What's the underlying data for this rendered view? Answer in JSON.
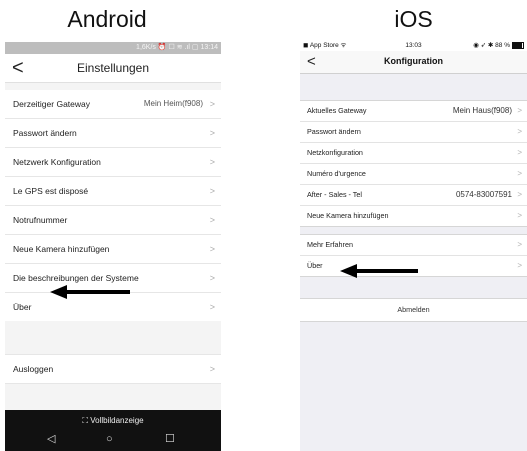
{
  "captions": {
    "android": "Android",
    "ios": "iOS"
  },
  "android": {
    "status_text": "1,6K/s ⏰ ☐ ≋ .ıl ▢ 13:14",
    "title": "Einstellungen",
    "back_glyph": "<",
    "items": [
      {
        "label": "Derzeitiger Gateway",
        "value": "Mein Heim(f908)"
      },
      {
        "label": "Passwort ändern",
        "value": ""
      },
      {
        "label": "Netzwerk Konfiguration",
        "value": ""
      },
      {
        "label": "Le GPS est disposé",
        "value": ""
      },
      {
        "label": "Notrufnummer",
        "value": ""
      },
      {
        "label": "Neue Kamera hinzufügen",
        "value": ""
      },
      {
        "label": "Die beschreibungen der Systeme",
        "value": ""
      },
      {
        "label": "Über",
        "value": ""
      }
    ],
    "logout": "Ausloggen",
    "fullscreen": "⛶ Vollbildanzeige",
    "nav": {
      "back": "◁",
      "home": "○",
      "recent": "☐"
    },
    "chevron": ">"
  },
  "ios": {
    "status_left": "◼ App Store ᯤ",
    "status_time": "13:03",
    "status_right": "◉ ➶ ✱ 88 %",
    "battery_level": 0.88,
    "title": "Konfiguration",
    "back_glyph": "<",
    "section1": [
      {
        "label": "Aktuelles Gateway",
        "value": "Mein Haus(f908)"
      },
      {
        "label": "Passwort ändern",
        "value": ""
      },
      {
        "label": "Netzkonfiguration",
        "value": ""
      },
      {
        "label": "Numéro d'urgence",
        "value": ""
      },
      {
        "label": "After - Sales - Tel",
        "value": "0574-83007591"
      },
      {
        "label": "Neue Kamera hinzufügen",
        "value": ""
      }
    ],
    "section2": [
      {
        "label": "Mehr Erfahren",
        "value": ""
      },
      {
        "label": "Über",
        "value": ""
      }
    ],
    "logout": "Abmelden",
    "chevron": ">"
  },
  "colors": {
    "arrow": "#000000",
    "android_nav": "#111111",
    "ios_bg": "#efeff4"
  }
}
